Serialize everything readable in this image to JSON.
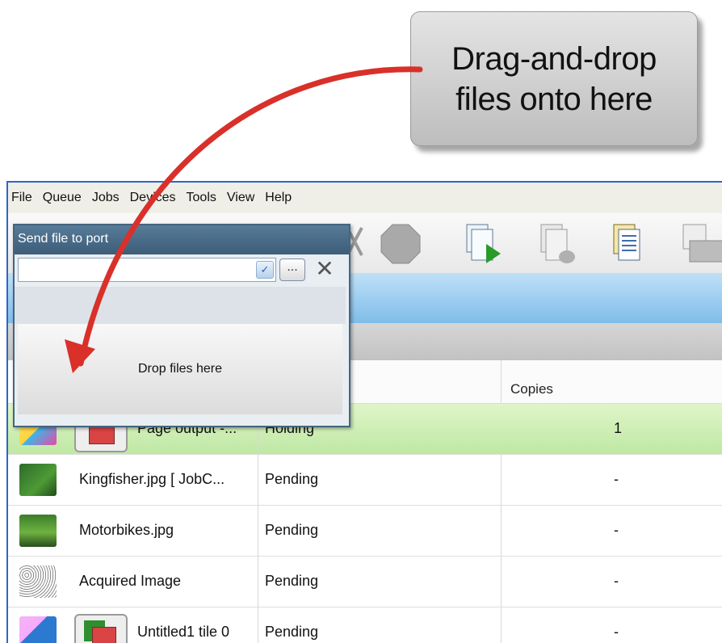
{
  "callout": {
    "line1": "Drag-and-drop",
    "line2": "files onto here"
  },
  "menu": [
    "File",
    "Queue",
    "Jobs",
    "Devices",
    "Tools",
    "View",
    "Help"
  ],
  "panel": {
    "title": "Send file to port",
    "browse_label": "...",
    "close_label": "✕",
    "dropdown_label": "✓",
    "drop_text": "Drop files here"
  },
  "table": {
    "headers": {
      "copies": "Copies"
    },
    "rows": [
      {
        "name": "Page output -...",
        "status": "Holding",
        "copies": "1"
      },
      {
        "name": "Kingfisher.jpg [ JobC...",
        "status": "Pending",
        "copies": "-"
      },
      {
        "name": "Motorbikes.jpg",
        "status": "Pending",
        "copies": "-"
      },
      {
        "name": "Acquired Image",
        "status": "Pending",
        "copies": "-"
      },
      {
        "name": "Untitled1 tile 0",
        "status": "Pending",
        "copies": "-"
      }
    ]
  },
  "colors": {
    "accent_blue": "#2e66c8",
    "arrow_red": "#d9302a",
    "selected_row": "#cdeeb4"
  }
}
